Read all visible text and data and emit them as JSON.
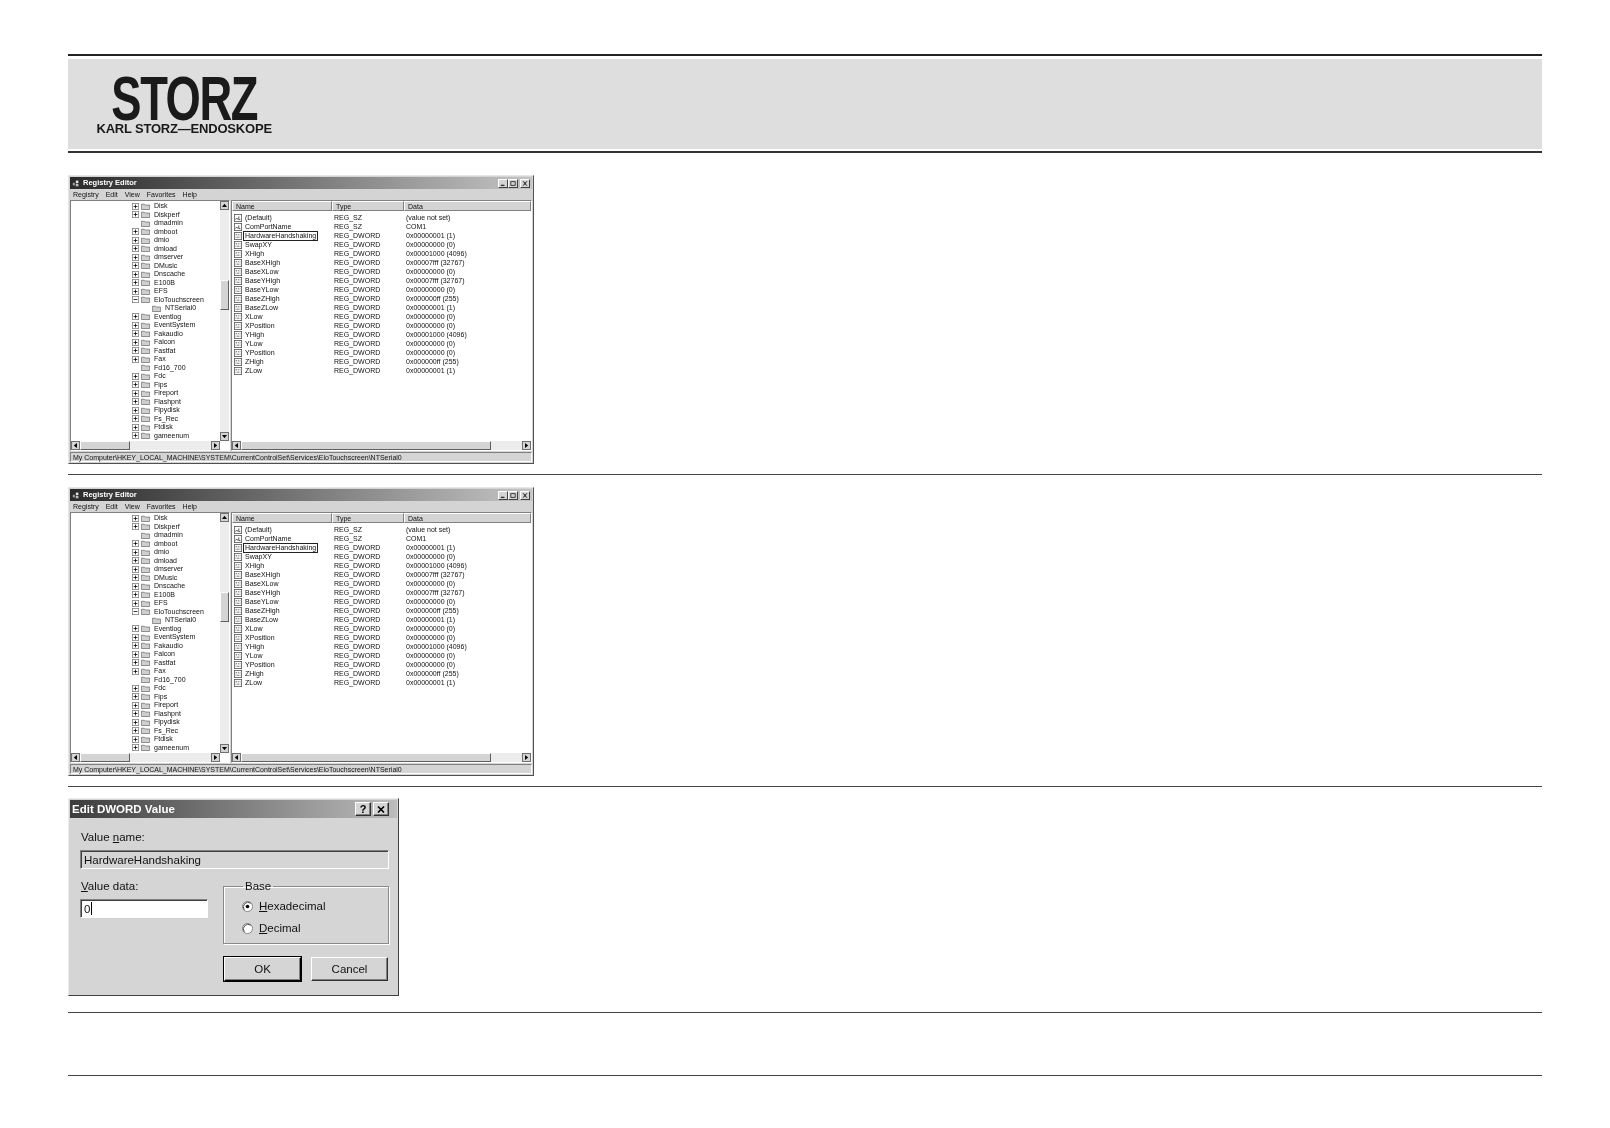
{
  "header": {
    "logo": {
      "wordmark": "STORZ",
      "tagline": "KARL STORZ—ENDOSKOPE"
    }
  },
  "figures": [
    {
      "kind": "registry_editor",
      "title": "Registry Editor",
      "menu": [
        "Registry",
        "Edit",
        "View",
        "Favorites",
        "Help"
      ],
      "tree": [
        {
          "label": "Disk",
          "expanded": false
        },
        {
          "label": "Diskperf",
          "expanded": false
        },
        {
          "label": "dmadmin"
        },
        {
          "label": "dmboot",
          "expanded": false
        },
        {
          "label": "dmio",
          "expanded": false
        },
        {
          "label": "dmload",
          "expanded": false
        },
        {
          "label": "dmserver",
          "expanded": false
        },
        {
          "label": "DMusic",
          "expanded": false
        },
        {
          "label": "Dnscache",
          "expanded": false
        },
        {
          "label": "E100B",
          "expanded": false
        },
        {
          "label": "EFS",
          "expanded": false
        },
        {
          "label": "EloTouchscreen",
          "expanded": true,
          "children": [
            {
              "label": "NTSerial0"
            }
          ]
        },
        {
          "label": "Eventlog",
          "expanded": false
        },
        {
          "label": "EventSystem",
          "expanded": false
        },
        {
          "label": "Fakaudio",
          "expanded": false
        },
        {
          "label": "Falcon",
          "expanded": false
        },
        {
          "label": "Fastfat",
          "expanded": false
        },
        {
          "label": "Fax",
          "expanded": false
        },
        {
          "label": "Fd16_700"
        },
        {
          "label": "Fdc",
          "expanded": false
        },
        {
          "label": "Fips",
          "expanded": false
        },
        {
          "label": "Fireport",
          "expanded": false
        },
        {
          "label": "Flashpnt",
          "expanded": false
        },
        {
          "label": "Flpydisk",
          "expanded": false
        },
        {
          "label": "Fs_Rec",
          "expanded": false
        },
        {
          "label": "Ftdisk",
          "expanded": false
        },
        {
          "label": "gameenum",
          "expanded": false
        }
      ],
      "columns": [
        "Name",
        "Type",
        "Data"
      ],
      "values": [
        {
          "kind": "sz",
          "name": "(Default)",
          "type": "REG_SZ",
          "data": "(value not set)",
          "selected": false
        },
        {
          "kind": "sz",
          "name": "ComPortName",
          "type": "REG_SZ",
          "data": "COM1",
          "selected": false
        },
        {
          "kind": "dword",
          "name": "HardwareHandshaking",
          "type": "REG_DWORD",
          "data": "0x00000001 (1)",
          "selected": true
        },
        {
          "kind": "dword",
          "name": "SwapXY",
          "type": "REG_DWORD",
          "data": "0x00000000 (0)",
          "selected": false
        },
        {
          "kind": "dword",
          "name": "XHigh",
          "type": "REG_DWORD",
          "data": "0x00001000 (4096)",
          "selected": false
        },
        {
          "kind": "dword",
          "name": "BaseXHigh",
          "type": "REG_DWORD",
          "data": "0x00007fff (32767)",
          "selected": false
        },
        {
          "kind": "dword",
          "name": "BaseXLow",
          "type": "REG_DWORD",
          "data": "0x00000000 (0)",
          "selected": false
        },
        {
          "kind": "dword",
          "name": "BaseYHigh",
          "type": "REG_DWORD",
          "data": "0x00007fff (32767)",
          "selected": false
        },
        {
          "kind": "dword",
          "name": "BaseYLow",
          "type": "REG_DWORD",
          "data": "0x00000000 (0)",
          "selected": false
        },
        {
          "kind": "dword",
          "name": "BaseZHigh",
          "type": "REG_DWORD",
          "data": "0x000000ff (255)",
          "selected": false
        },
        {
          "kind": "dword",
          "name": "BaseZLow",
          "type": "REG_DWORD",
          "data": "0x00000001 (1)",
          "selected": false
        },
        {
          "kind": "dword",
          "name": "XLow",
          "type": "REG_DWORD",
          "data": "0x00000000 (0)",
          "selected": false
        },
        {
          "kind": "dword",
          "name": "XPosition",
          "type": "REG_DWORD",
          "data": "0x00000000 (0)",
          "selected": false
        },
        {
          "kind": "dword",
          "name": "YHigh",
          "type": "REG_DWORD",
          "data": "0x00001000 (4096)",
          "selected": false
        },
        {
          "kind": "dword",
          "name": "YLow",
          "type": "REG_DWORD",
          "data": "0x00000000 (0)",
          "selected": false
        },
        {
          "kind": "dword",
          "name": "YPosition",
          "type": "REG_DWORD",
          "data": "0x00000000 (0)",
          "selected": false
        },
        {
          "kind": "dword",
          "name": "ZHigh",
          "type": "REG_DWORD",
          "data": "0x000000ff (255)",
          "selected": false
        },
        {
          "kind": "dword",
          "name": "ZLow",
          "type": "REG_DWORD",
          "data": "0x00000001 (1)",
          "selected": false
        }
      ],
      "status_bar": "My Computer\\HKEY_LOCAL_MACHINE\\SYSTEM\\CurrentControlSet\\Services\\EloTouchscreen\\NTSerial0"
    },
    {
      "kind": "registry_editor",
      "title": "Registry Editor",
      "menu": [
        "Registry",
        "Edit",
        "View",
        "Favorites",
        "Help"
      ],
      "tree": [
        {
          "label": "Disk",
          "expanded": false
        },
        {
          "label": "Diskperf",
          "expanded": false
        },
        {
          "label": "dmadmin"
        },
        {
          "label": "dmboot",
          "expanded": false
        },
        {
          "label": "dmio",
          "expanded": false
        },
        {
          "label": "dmload",
          "expanded": false
        },
        {
          "label": "dmserver",
          "expanded": false
        },
        {
          "label": "DMusic",
          "expanded": false
        },
        {
          "label": "Dnscache",
          "expanded": false
        },
        {
          "label": "E100B",
          "expanded": false
        },
        {
          "label": "EFS",
          "expanded": false
        },
        {
          "label": "EloTouchscreen",
          "expanded": true,
          "children": [
            {
              "label": "NTSerial0"
            }
          ]
        },
        {
          "label": "Eventlog",
          "expanded": false
        },
        {
          "label": "EventSystem",
          "expanded": false
        },
        {
          "label": "Fakaudio",
          "expanded": false
        },
        {
          "label": "Falcon",
          "expanded": false
        },
        {
          "label": "Fastfat",
          "expanded": false
        },
        {
          "label": "Fax",
          "expanded": false
        },
        {
          "label": "Fd16_700"
        },
        {
          "label": "Fdc",
          "expanded": false
        },
        {
          "label": "Fips",
          "expanded": false
        },
        {
          "label": "Fireport",
          "expanded": false
        },
        {
          "label": "Flashpnt",
          "expanded": false
        },
        {
          "label": "Flpydisk",
          "expanded": false
        },
        {
          "label": "Fs_Rec",
          "expanded": false
        },
        {
          "label": "Ftdisk",
          "expanded": false
        },
        {
          "label": "gameenum",
          "expanded": false
        }
      ],
      "columns": [
        "Name",
        "Type",
        "Data"
      ],
      "values": [
        {
          "kind": "sz",
          "name": "(Default)",
          "type": "REG_SZ",
          "data": "(value not set)",
          "selected": false
        },
        {
          "kind": "sz",
          "name": "ComPortName",
          "type": "REG_SZ",
          "data": "COM1",
          "selected": false
        },
        {
          "kind": "dword",
          "name": "HardwareHandshaking",
          "type": "REG_DWORD",
          "data": "0x00000001 (1)",
          "selected": true
        },
        {
          "kind": "dword",
          "name": "SwapXY",
          "type": "REG_DWORD",
          "data": "0x00000000 (0)",
          "selected": false
        },
        {
          "kind": "dword",
          "name": "XHigh",
          "type": "REG_DWORD",
          "data": "0x00001000 (4096)",
          "selected": false
        },
        {
          "kind": "dword",
          "name": "BaseXHigh",
          "type": "REG_DWORD",
          "data": "0x00007fff (32767)",
          "selected": false
        },
        {
          "kind": "dword",
          "name": "BaseXLow",
          "type": "REG_DWORD",
          "data": "0x00000000 (0)",
          "selected": false
        },
        {
          "kind": "dword",
          "name": "BaseYHigh",
          "type": "REG_DWORD",
          "data": "0x00007fff (32767)",
          "selected": false
        },
        {
          "kind": "dword",
          "name": "BaseYLow",
          "type": "REG_DWORD",
          "data": "0x00000000 (0)",
          "selected": false
        },
        {
          "kind": "dword",
          "name": "BaseZHigh",
          "type": "REG_DWORD",
          "data": "0x000000ff (255)",
          "selected": false
        },
        {
          "kind": "dword",
          "name": "BaseZLow",
          "type": "REG_DWORD",
          "data": "0x00000001 (1)",
          "selected": false
        },
        {
          "kind": "dword",
          "name": "XLow",
          "type": "REG_DWORD",
          "data": "0x00000000 (0)",
          "selected": false
        },
        {
          "kind": "dword",
          "name": "XPosition",
          "type": "REG_DWORD",
          "data": "0x00000000 (0)",
          "selected": false
        },
        {
          "kind": "dword",
          "name": "YHigh",
          "type": "REG_DWORD",
          "data": "0x00001000 (4096)",
          "selected": false
        },
        {
          "kind": "dword",
          "name": "YLow",
          "type": "REG_DWORD",
          "data": "0x00000000 (0)",
          "selected": false
        },
        {
          "kind": "dword",
          "name": "YPosition",
          "type": "REG_DWORD",
          "data": "0x00000000 (0)",
          "selected": false
        },
        {
          "kind": "dword",
          "name": "ZHigh",
          "type": "REG_DWORD",
          "data": "0x000000ff (255)",
          "selected": false
        },
        {
          "kind": "dword",
          "name": "ZLow",
          "type": "REG_DWORD",
          "data": "0x00000001 (1)",
          "selected": false
        }
      ],
      "status_bar": "My Computer\\HKEY_LOCAL_MACHINE\\SYSTEM\\CurrentControlSet\\Services\\EloTouchscreen\\NTSerial0"
    },
    {
      "kind": "dword_dialog",
      "title": "Edit DWORD Value",
      "help_button": "?",
      "value_name": {
        "label": {
          "before": "Value ",
          "key": "n",
          "after": "ame:"
        },
        "value": "HardwareHandshaking",
        "disabled": true
      },
      "value_data": {
        "label": {
          "key": "V",
          "after": "alue data:"
        },
        "value": "0",
        "focused": true
      },
      "base": {
        "label": "Base",
        "options": [
          {
            "label": {
              "key": "H",
              "after": "exadecimal"
            },
            "selected": true
          },
          {
            "label": {
              "key": "D",
              "after": "ecimal"
            },
            "selected": false
          }
        ]
      },
      "buttons": [
        {
          "label": "OK",
          "default": true
        },
        {
          "label": "Cancel",
          "default": false
        }
      ]
    }
  ]
}
